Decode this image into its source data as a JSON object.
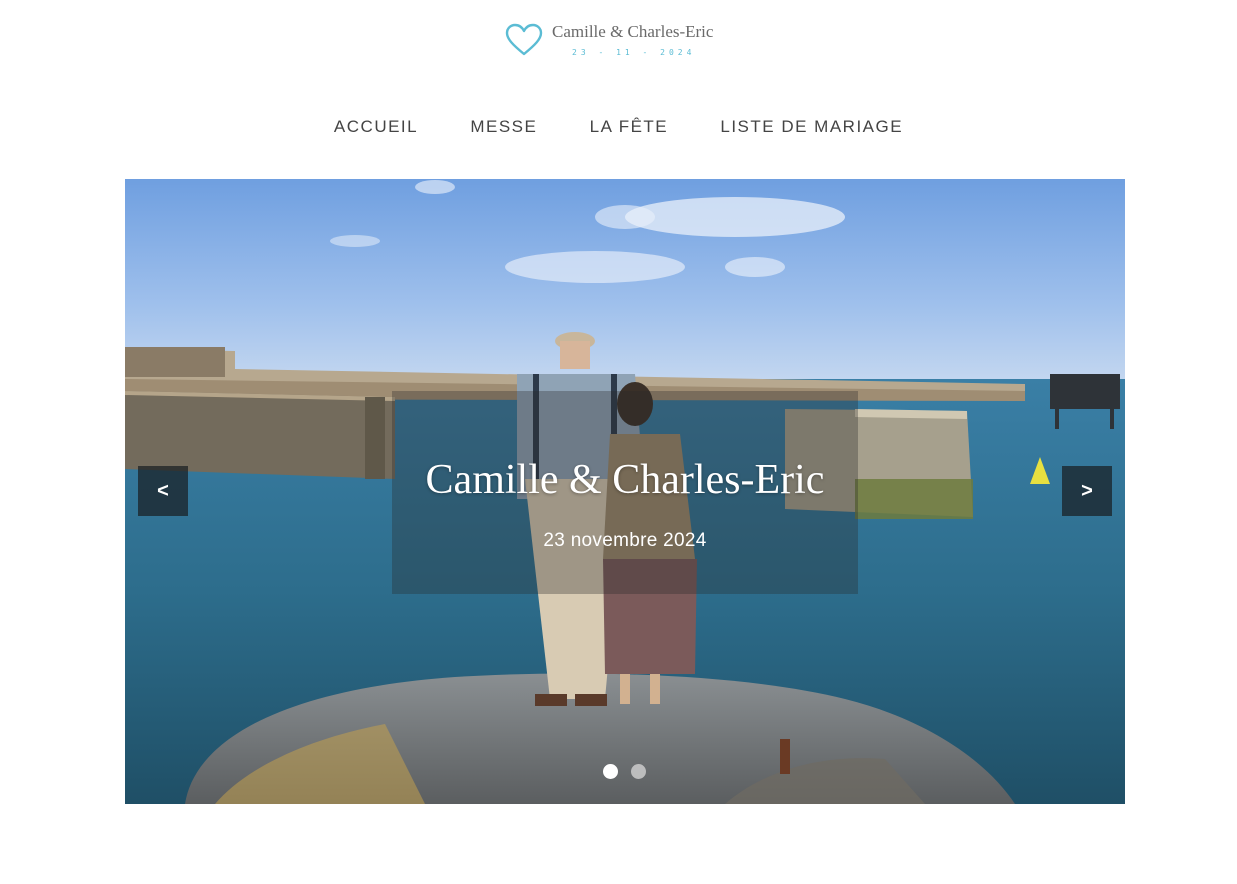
{
  "logo": {
    "names": "Camille & Charles-Eric",
    "date": "23 - 11 - 2024",
    "heart_color": "#5bbcd4"
  },
  "nav": {
    "items": [
      {
        "label": "ACCUEIL"
      },
      {
        "label": "MESSE"
      },
      {
        "label": "LA FÊTE"
      },
      {
        "label": "LISTE DE MARIAGE"
      }
    ]
  },
  "slider": {
    "title": "Camille & Charles-Eric",
    "subtitle": "23 novembre 2024",
    "prev_label": "<",
    "next_label": ">",
    "slide_count": 2,
    "active_slide": 1
  }
}
